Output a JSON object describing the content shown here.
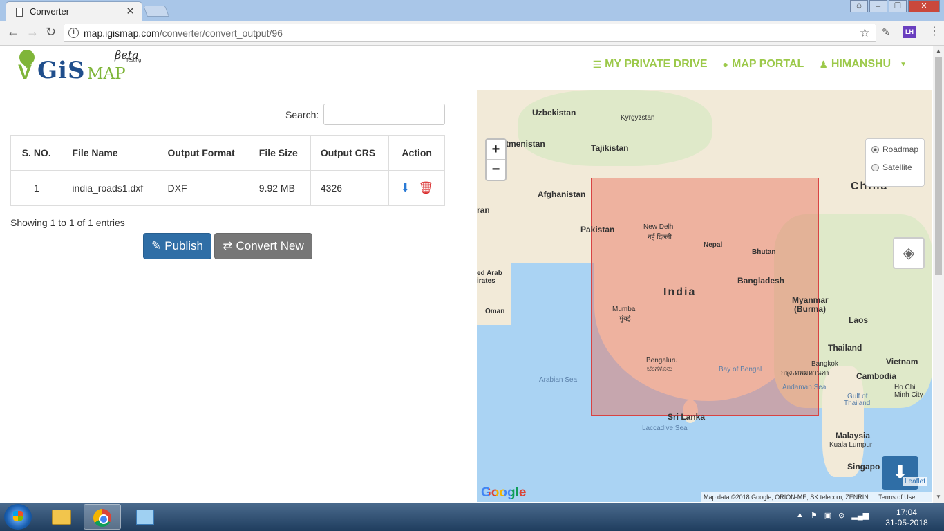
{
  "browser": {
    "tab_title": "Converter",
    "tab_close": "✕",
    "url_host": "map.igismap.com",
    "url_path": "/converter/convert_output/96",
    "ext_badge": "LH"
  },
  "header": {
    "logo_main": "GiS",
    "logo_sub": "MAP",
    "logo_beta": "βeta",
    "logo_testing": "Testing",
    "nav": [
      {
        "label": "MY PRIVATE DRIVE",
        "icon": "database-icon"
      },
      {
        "label": "MAP PORTAL",
        "icon": "globe-icon"
      },
      {
        "label": "HIMANSHU",
        "icon": "user-icon"
      }
    ]
  },
  "search": {
    "label": "Search:",
    "value": ""
  },
  "table": {
    "columns": [
      "S. NO.",
      "File Name",
      "Output Format",
      "File Size",
      "Output CRS",
      "Action"
    ],
    "rows": [
      {
        "sno": "1",
        "file_name": "india_roads1.dxf",
        "format": "DXF",
        "size": "9.92 MB",
        "crs": "4326"
      }
    ]
  },
  "showing": "Showing 1 to 1 of 1 entries",
  "buttons": {
    "publish": "Publish",
    "convert_new": "Convert New"
  },
  "map": {
    "zoom_in": "+",
    "zoom_out": "−",
    "layer_options": [
      "Roadmap",
      "Satellite"
    ],
    "selected_layer": "Roadmap",
    "labels": {
      "uzbekistan": "Uzbekistan",
      "kyrgyzstan": "Kyrgyzstan",
      "turkmenistan": "tmenistan",
      "tajikistan": "Tajikistan",
      "afghanistan": "Afghanistan",
      "iran": "ran",
      "pakistan": "Pakistan",
      "new_delhi": "New Delhi",
      "new_delhi_local": "नई दिल्ली",
      "nepal": "Nepal",
      "bhutan": "Bhutan",
      "china": "China",
      "india": "India",
      "bangladesh": "Bangladesh",
      "myanmar": "Myanmar",
      "burma": "(Burma)",
      "uae_1": "ed Arab",
      "uae_2": "irates",
      "oman": "Oman",
      "mumbai": "Mumbai",
      "mumbai_local": "मुंबई",
      "laos": "Laos",
      "thailand": "Thailand",
      "vietnam": "Vietnam",
      "bangkok": "Bangkok",
      "bangkok_local": "กรุงเทพมหานคร",
      "cambodia": "Cambodia",
      "hochiminh_1": "Ho Chi",
      "hochiminh_2": "Minh City",
      "arabian_sea": "Arabian Sea",
      "bay_of_bengal": "Bay of Bengal",
      "andaman_sea": "Andaman Sea",
      "gulf_thailand_1": "Gulf of",
      "gulf_thailand_2": "Thailand",
      "bengaluru": "Bengaluru",
      "bengaluru_local": "ಬೆಂಗಳೂರು",
      "sri_lanka": "Sri Lanka",
      "laccadive_sea": "Laccadive Sea",
      "malaysia": "Malaysia",
      "kuala_lumpur": "Kuala Lumpur",
      "singapore": "Singapo"
    },
    "leaflet": "Leaflet",
    "google": "Google",
    "attribution": "Map data ©2018 Google, ORION-ME, SK telecom, ZENRIN",
    "terms": "Terms of Use"
  },
  "taskbar": {
    "time": "17:04",
    "date": "31-05-2018"
  }
}
